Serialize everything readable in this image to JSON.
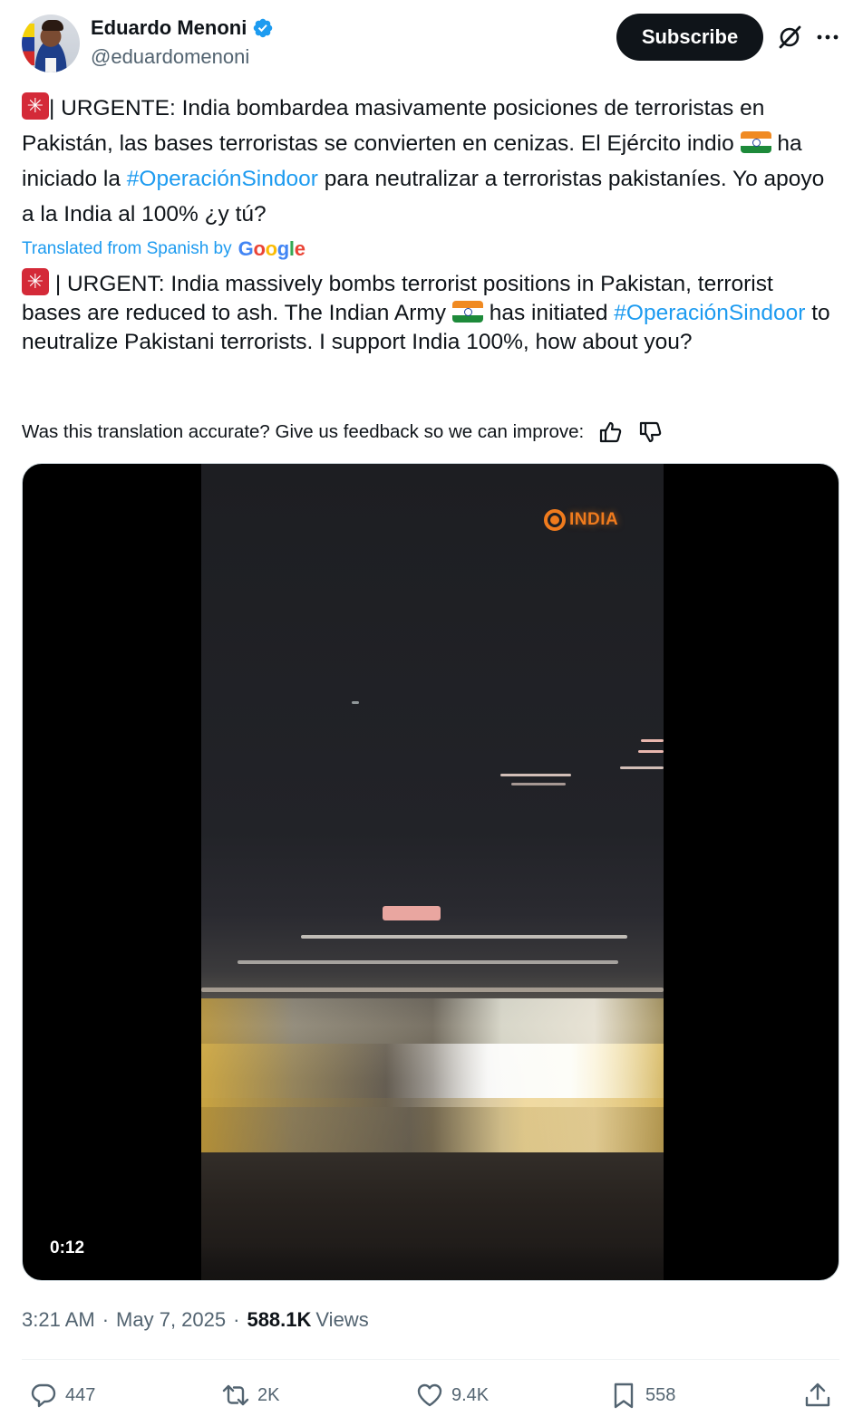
{
  "author": {
    "display_name": "Eduardo Menoni",
    "handle": "@eduardomenoni",
    "verified": true
  },
  "header": {
    "subscribe_label": "Subscribe"
  },
  "post": {
    "original_text": {
      "p1": "| URGENTE: India bombardea masivamente posiciones de terroristas en Pakistán, las bases terroristas se convierten en cenizas. El Ejército indio",
      "p2": "ha iniciado la",
      "hashtag": "#OperaciónSindoor",
      "p3": "para neutralizar a terroristas pakistaníes. Yo apoyo a la India al 100% ¿y tú?"
    },
    "translated_label": "Translated from Spanish by",
    "translated_brand": "Google",
    "translation_text": {
      "p1": "| URGENT: India massively bombs terrorist positions in Pakistan, terrorist bases are reduced to ash. The Indian Army",
      "p2": "has initiated",
      "hashtag": "#OperaciónSindoor",
      "p3": "to neutralize Pakistani terrorists. I support India 100%, how about you?"
    },
    "feedback_prompt": "Was this translation accurate? Give us feedback so we can improve:"
  },
  "media": {
    "watermark": "INDIA",
    "duration": "0:12"
  },
  "meta": {
    "time": "3:21 AM",
    "separator": "·",
    "date": "May 7, 2025",
    "views_count": "588.1K",
    "views_label": "Views"
  },
  "actions": {
    "replies": "447",
    "reposts": "2K",
    "likes": "9.4K",
    "bookmarks": "558"
  },
  "colors": {
    "link": "#1d9bf0",
    "secondary_text": "#536471",
    "primary_text": "#0f1419",
    "subscribe_bg": "#0f1419"
  }
}
